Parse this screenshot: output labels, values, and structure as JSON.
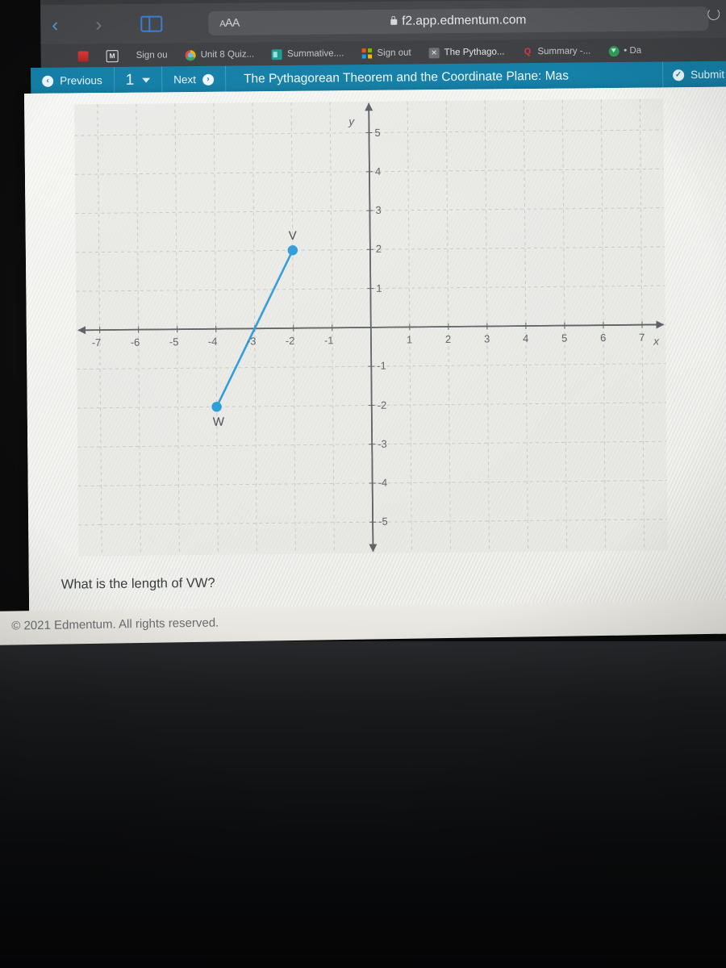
{
  "browser": {
    "back_icon": "chevron-left-icon",
    "forward_icon": "chevron-right-icon",
    "sidebar_icon": "sidebar-icon",
    "reader_label": "AA",
    "lock_icon": "lock-icon",
    "url": "f2.app.edmentum.com",
    "reload_icon": "reload-icon"
  },
  "bookmarks": [
    {
      "label": "",
      "icon": "red-favicon"
    },
    {
      "label": "",
      "icon": "monogram-m-icon"
    },
    {
      "label": "Sign ou",
      "icon": ""
    },
    {
      "label": "Unit 8 Quiz...",
      "icon": "chrome-icon"
    },
    {
      "label": "Summative....",
      "icon": "teal-doc-icon"
    },
    {
      "label": "Sign out",
      "icon": "microsoft-icon"
    },
    {
      "label": "The Pythago...",
      "icon": "x-favicon"
    },
    {
      "label": "Summary -...",
      "icon": "quizlet-q-icon"
    },
    {
      "label": "• Da",
      "icon": "green-download-icon"
    }
  ],
  "appbar": {
    "previous_label": "Previous",
    "previous_icon": "arrow-left-circle-icon",
    "page_number": "1",
    "page_dropdown_icon": "chevron-down-icon",
    "next_label": "Next",
    "next_icon": "arrow-right-circle-icon",
    "activity_title": "The Pythagorean Theorem and the Coordinate Plane: Mas",
    "submit_label": "Submit",
    "submit_icon": "check-circle-icon",
    "accent_color": "#1580a8"
  },
  "question": {
    "text": "What is the length of VW?"
  },
  "footer": {
    "copyright": "© 2021 Edmentum. All rights reserved."
  },
  "chart_data": {
    "type": "scatter",
    "title": "",
    "xlabel": "x",
    "ylabel": "y",
    "xlim": [
      -7.6,
      7.6
    ],
    "ylim": [
      -5.8,
      5.8
    ],
    "x_ticks": [
      -7,
      -6,
      -5,
      -4,
      -3,
      -2,
      -1,
      1,
      2,
      3,
      4,
      5,
      6,
      7
    ],
    "y_ticks": [
      5,
      4,
      3,
      2,
      1,
      -1,
      -2,
      -3,
      -4,
      -5
    ],
    "grid": true,
    "grid_style": "dashed",
    "grid_color": "#c9c9c4",
    "axis_color": "#5d6165",
    "series_color": "#2b9bd8",
    "points": [
      {
        "label": "V",
        "x": -2,
        "y": 2
      },
      {
        "label": "W",
        "x": -4,
        "y": -2
      }
    ],
    "segments": [
      {
        "name": "VW",
        "from": "V",
        "to": "W"
      }
    ],
    "legend": []
  }
}
